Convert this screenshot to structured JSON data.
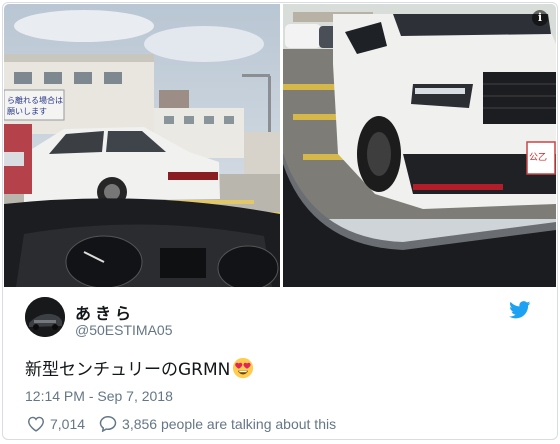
{
  "tweet": {
    "author_name": "あきら",
    "handle": "@50ESTIMA05",
    "text": "新型センチュリーのGRMN",
    "timestamp": "12:14 PM - Sep 7, 2018",
    "likes": "7,014",
    "talking": "3,856 people are talking about this"
  },
  "media": {
    "info_label": "i",
    "sign_text_1": "ら離れる場合は",
    "sign_text_2": "願いします",
    "plate_text": "公乙"
  },
  "colors": {
    "twitter_blue": "#1da1f2",
    "text_gray": "#657786",
    "text_dark": "#14171a"
  },
  "icons": [
    "info-icon",
    "twitter-bird-icon",
    "heart-icon",
    "comment-bubble-icon",
    "heart-eyes-emoji-icon"
  ]
}
